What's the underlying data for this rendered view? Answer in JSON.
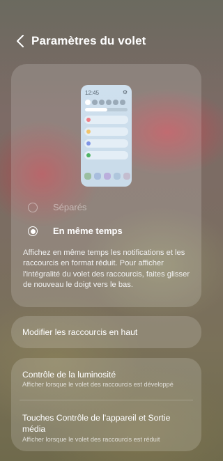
{
  "header": {
    "title": "Paramètres du volet",
    "back_icon": "chevron-left-icon"
  },
  "preview": {
    "time": "12:45",
    "settings_icon": "gear-icon",
    "row_colors": [
      "#f07e86",
      "#f2c46a",
      "#7f95e6",
      "#4fb365"
    ]
  },
  "layout_options": {
    "selected": "En même temps",
    "options": [
      {
        "label": "Séparés",
        "selected": false
      },
      {
        "label": "En même temps",
        "selected": true
      }
    ],
    "description": "Affichez en même temps les notifications et les raccourcis en format réduit. Pour afficher l'intégralité du volet des raccourcis, faites glisser de nouveau le doigt vers le bas."
  },
  "shortcuts": {
    "label": "Modifier les raccourcis en haut"
  },
  "settings": {
    "brightness": {
      "title": "Contrôle de la luminosité",
      "subtitle": "Afficher lorsque le volet des raccourcis est développé"
    },
    "device_media": {
      "title": "Touches Contrôle de l'appareil et Sortie média",
      "subtitle": "Afficher lorsque le volet des raccourcis est réduit"
    }
  }
}
